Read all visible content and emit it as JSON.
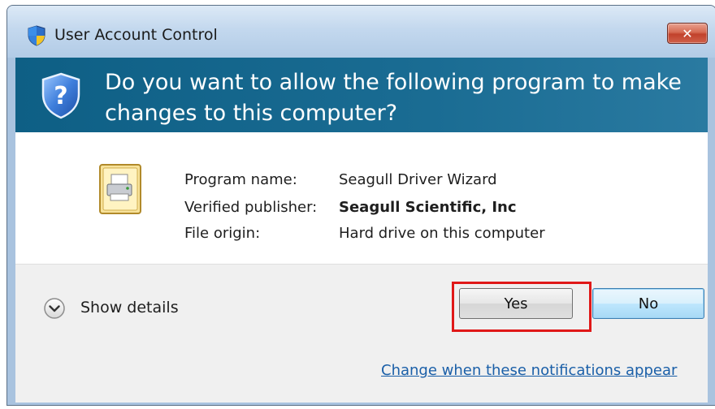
{
  "window": {
    "title": "User Account Control",
    "close_label": "✕"
  },
  "banner": {
    "question": "Do you want to allow the following program to make changes to this computer?"
  },
  "program_info": {
    "rows": [
      {
        "label": "Program name:",
        "value": "Seagull Driver Wizard",
        "bold": false
      },
      {
        "label": "Verified publisher:",
        "value": "Seagull Scientific, Inc",
        "bold": true
      },
      {
        "label": "File origin:",
        "value": "Hard drive on this computer",
        "bold": false
      }
    ]
  },
  "footer": {
    "details_label": "Show details",
    "yes_label": "Yes",
    "no_label": "No",
    "link_text": "Change when these notifications appear"
  },
  "icons": {
    "title": "uac-shield-icon",
    "banner": "question-shield-icon",
    "program": "printer-driver-icon",
    "details": "chevron-down-icon"
  },
  "colors": {
    "banner_bg": "#1a6c93",
    "link": "#1a5fa8",
    "highlight": "#e01818",
    "close": "#c1412c"
  }
}
